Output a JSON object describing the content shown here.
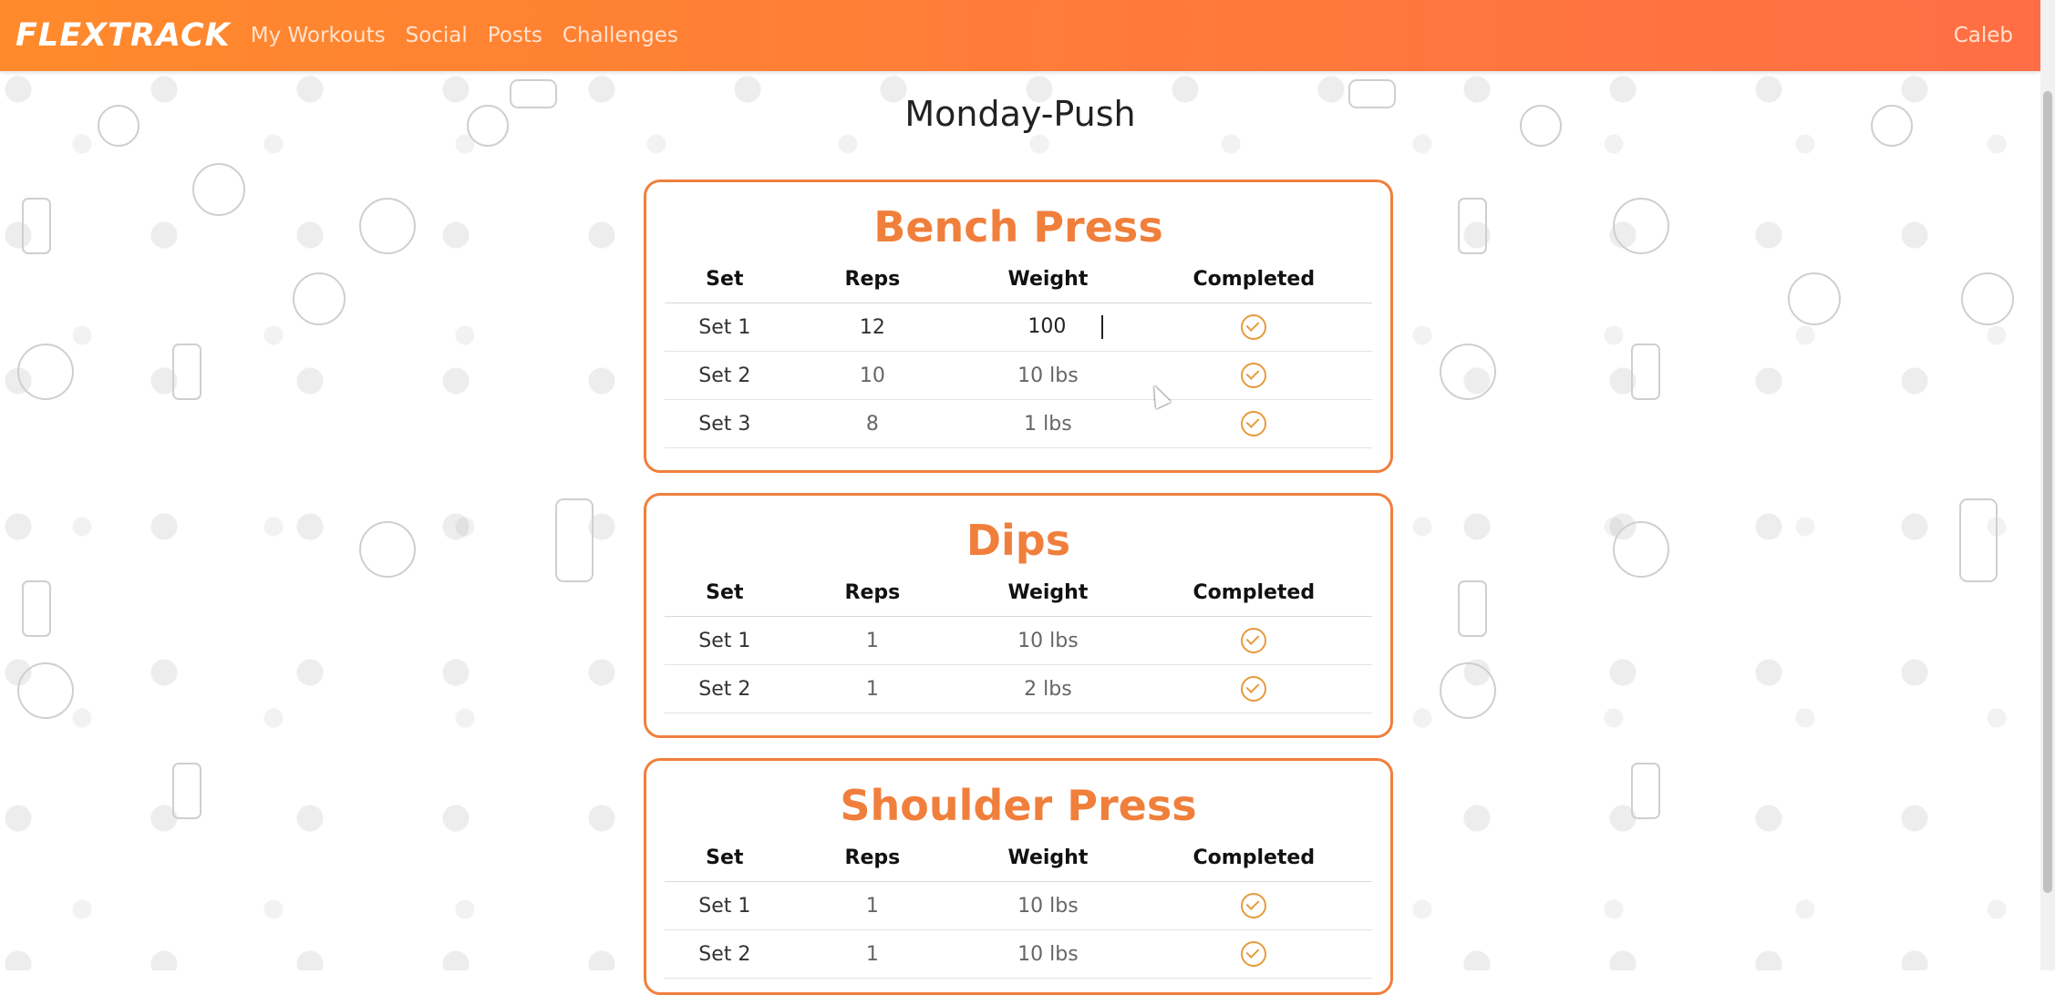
{
  "app": {
    "brand": "FLEXTRACK",
    "nav": [
      "My Workouts",
      "Social",
      "Posts",
      "Challenges"
    ],
    "user": "Caleb"
  },
  "workout": {
    "title": "Monday-Push",
    "columns": [
      "Set",
      "Reps",
      "Weight",
      "Completed"
    ],
    "exercises": [
      {
        "name": "Bench Press",
        "sets": [
          {
            "set": "Set 1",
            "reps": "12",
            "weight": "100",
            "completed": true
          },
          {
            "set": "Set 2",
            "reps": "10",
            "weight": "10 lbs",
            "completed": true
          },
          {
            "set": "Set 3",
            "reps": "8",
            "weight": "1 lbs",
            "completed": true
          }
        ]
      },
      {
        "name": "Dips",
        "sets": [
          {
            "set": "Set 1",
            "reps": "1",
            "weight": "10 lbs",
            "completed": true
          },
          {
            "set": "Set 2",
            "reps": "1",
            "weight": "2 lbs",
            "completed": true
          }
        ]
      },
      {
        "name": "Shoulder Press",
        "sets": [
          {
            "set": "Set 1",
            "reps": "1",
            "weight": "10 lbs",
            "completed": true
          },
          {
            "set": "Set 2",
            "reps": "1",
            "weight": "10 lbs",
            "completed": true
          }
        ]
      }
    ]
  },
  "colors": {
    "accent": "#f07f3c",
    "nav_start": "#ff8a2c",
    "nav_end": "#ff6e45",
    "check": "#e79a3c"
  }
}
